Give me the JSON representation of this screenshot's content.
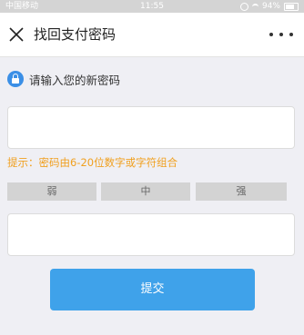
{
  "status_bar": {
    "carrier": "中国移动",
    "time": "11:55",
    "battery": "94%"
  },
  "nav": {
    "title": "找回支付密码"
  },
  "form": {
    "prompt": "请输入您的新密码",
    "new_password": {
      "value": "",
      "placeholder": ""
    },
    "hint": "提示：密码由6-20位数字或字符组合",
    "strength_labels": [
      "弱",
      "中",
      "强"
    ],
    "confirm_password": {
      "value": "",
      "placeholder": ""
    },
    "submit_label": "提交"
  },
  "colors": {
    "accent": "#3fa2ea",
    "hint": "#f0a020",
    "lock_icon": "#3b8fe6",
    "strength_inactive": "#d3d3d3"
  }
}
